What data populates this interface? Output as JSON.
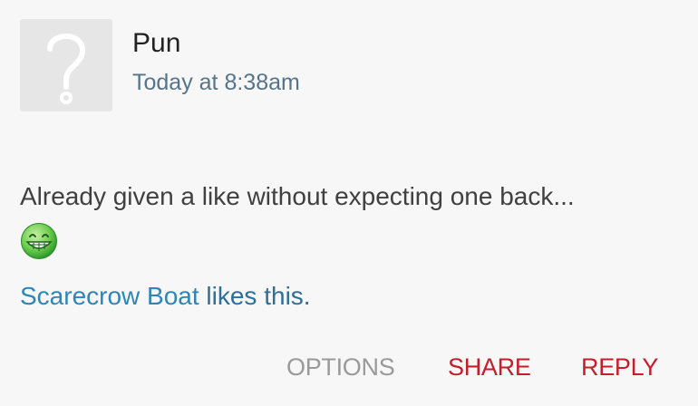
{
  "post": {
    "author": "Pun",
    "timestamp": "Today at 8:38am",
    "comment": "Already given a like without expecting one back...",
    "emoji_icon": "grinning-face-emoji"
  },
  "likes": {
    "user": "Scarecrow Boat",
    "suffix": " likes this."
  },
  "actions": {
    "options": "OPTIONS",
    "share": "SHARE",
    "reply": "REPLY"
  },
  "colors": {
    "background": "#f7f7f7",
    "link": "#2f86b6",
    "accent": "#c41e2a",
    "muted": "#9a9a9a"
  }
}
